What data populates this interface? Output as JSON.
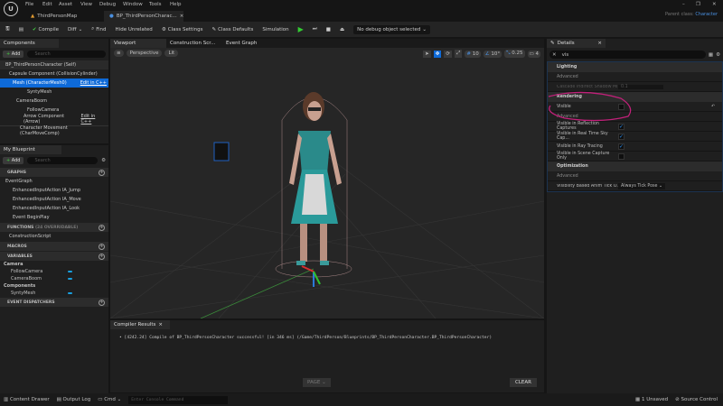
{
  "menu": [
    "File",
    "Edit",
    "Asset",
    "View",
    "Debug",
    "Window",
    "Tools",
    "Help"
  ],
  "doc_tabs": [
    {
      "label": "ThirdPersonMap"
    },
    {
      "label": "BP_ThirdPersonCharac..."
    }
  ],
  "parent_class": {
    "label": "Parent class:",
    "value": "Character"
  },
  "toolbar": {
    "compile": "Compile",
    "diff": "Diff",
    "find": "Find",
    "hide_unrelated": "Hide Unrelated",
    "class_settings": "Class Settings",
    "class_defaults": "Class Defaults",
    "simulation": "Simulation",
    "debug_object": "No debug object selected"
  },
  "components": {
    "title": "Components",
    "add": "Add",
    "search_placeholder": "Search",
    "items": [
      "BP_ThirdPersonCharacter (Self)",
      "Capsule Component (CollisionCylinder)",
      "Mesh (CharacterMesh0)",
      "SyntyMesh",
      "CameraBoom",
      "FollowCamera",
      "Arrow Component (Arrow)",
      "Character Movement (CharMoveComp)"
    ],
    "edit_cpp": "Edit in C++"
  },
  "my_blueprint": {
    "title": "My Blueprint",
    "add": "Add",
    "search_placeholder": "Search",
    "graphs": "GRAPHS",
    "event_graph": "EventGraph",
    "events": [
      "EnhancedInputAction IA_Jump",
      "EnhancedInputAction IA_Move",
      "EnhancedInputAction IA_Look",
      "Event BeginPlay"
    ],
    "functions": "FUNCTIONS",
    "functions_note": "(24 OVERRIDABLE)",
    "construction": "ConstructionScript",
    "macros": "MACROS",
    "variables": "VARIABLES",
    "var_groups": [
      {
        "name": "Camera",
        "vars": [
          "FollowCamera",
          "CameraBoom"
        ]
      },
      {
        "name": "Components",
        "vars": [
          "SyntyMesh"
        ]
      }
    ],
    "dispatchers": "EVENT DISPATCHERS"
  },
  "editor_tabs": [
    "Viewport",
    "Construction Scr...",
    "Event Graph"
  ],
  "viewport": {
    "perspective": "Perspective",
    "lit": "Lit",
    "grid": "10",
    "rot": "10°",
    "scale": "0.25",
    "cam": "4"
  },
  "compiler": {
    "title": "Compiler Results",
    "message": "[4242.24] Compile of BP_ThirdPersonCharacter successful! [in 346 ms] (/Game/ThirdPerson/Blueprints/BP_ThirdPersonCharacter.BP_ThirdPersonCharacter)",
    "page": "PAGE",
    "clear": "CLEAR"
  },
  "details": {
    "title": "Details",
    "search_value": "vis",
    "lighting": "Lighting",
    "advanced": "Advanced",
    "shadow_label": "Cascade Indirect Shadow Min...",
    "shadow_value": "0.1",
    "rendering": "Rendering",
    "visible": "Visible",
    "visible_checked": false,
    "checks": [
      {
        "label": "Visible in Reflection Captures",
        "checked": true
      },
      {
        "label": "Visible in Real Time Sky Cap...",
        "checked": true
      },
      {
        "label": "Visible in Ray Tracing",
        "checked": true
      },
      {
        "label": "Visible in Scene Capture Only",
        "checked": false
      }
    ],
    "optimization": "Optimization",
    "anim_label": "Visibility Based Anim Tick O...",
    "anim_value": "Always Tick Pose"
  },
  "status": {
    "content_drawer": "Content Drawer",
    "output_log": "Output Log",
    "cmd": "Cmd",
    "console_placeholder": "Enter Console Command",
    "unsaved": "1 Unsaved",
    "source_control": "Source Control"
  },
  "colors": {
    "accent": "#0e6ad8",
    "annotation": "#c2207a",
    "link": "#4a90e0"
  }
}
